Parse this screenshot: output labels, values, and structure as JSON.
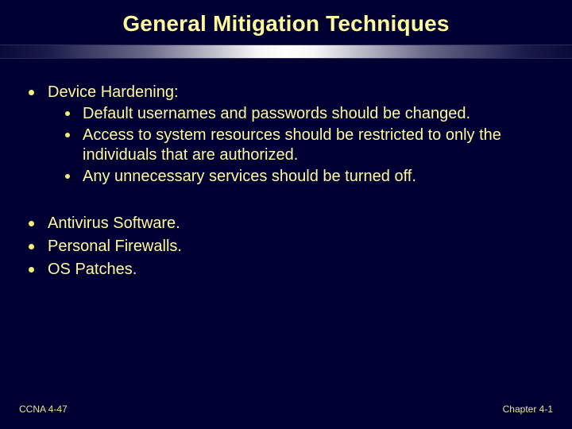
{
  "title": "General Mitigation Techniques",
  "main_heading": "Device Hardening:",
  "sub_items": [
    "Default usernames and passwords should be changed.",
    "Access to system resources should be restricted to only the individuals that are authorized.",
    "Any unnecessary services should be turned off."
  ],
  "bullets2": [
    "Antivirus Software.",
    "Personal Firewalls.",
    "OS Patches."
  ],
  "footer": {
    "left": "CCNA 4-47",
    "right": "Chapter 4-1"
  }
}
